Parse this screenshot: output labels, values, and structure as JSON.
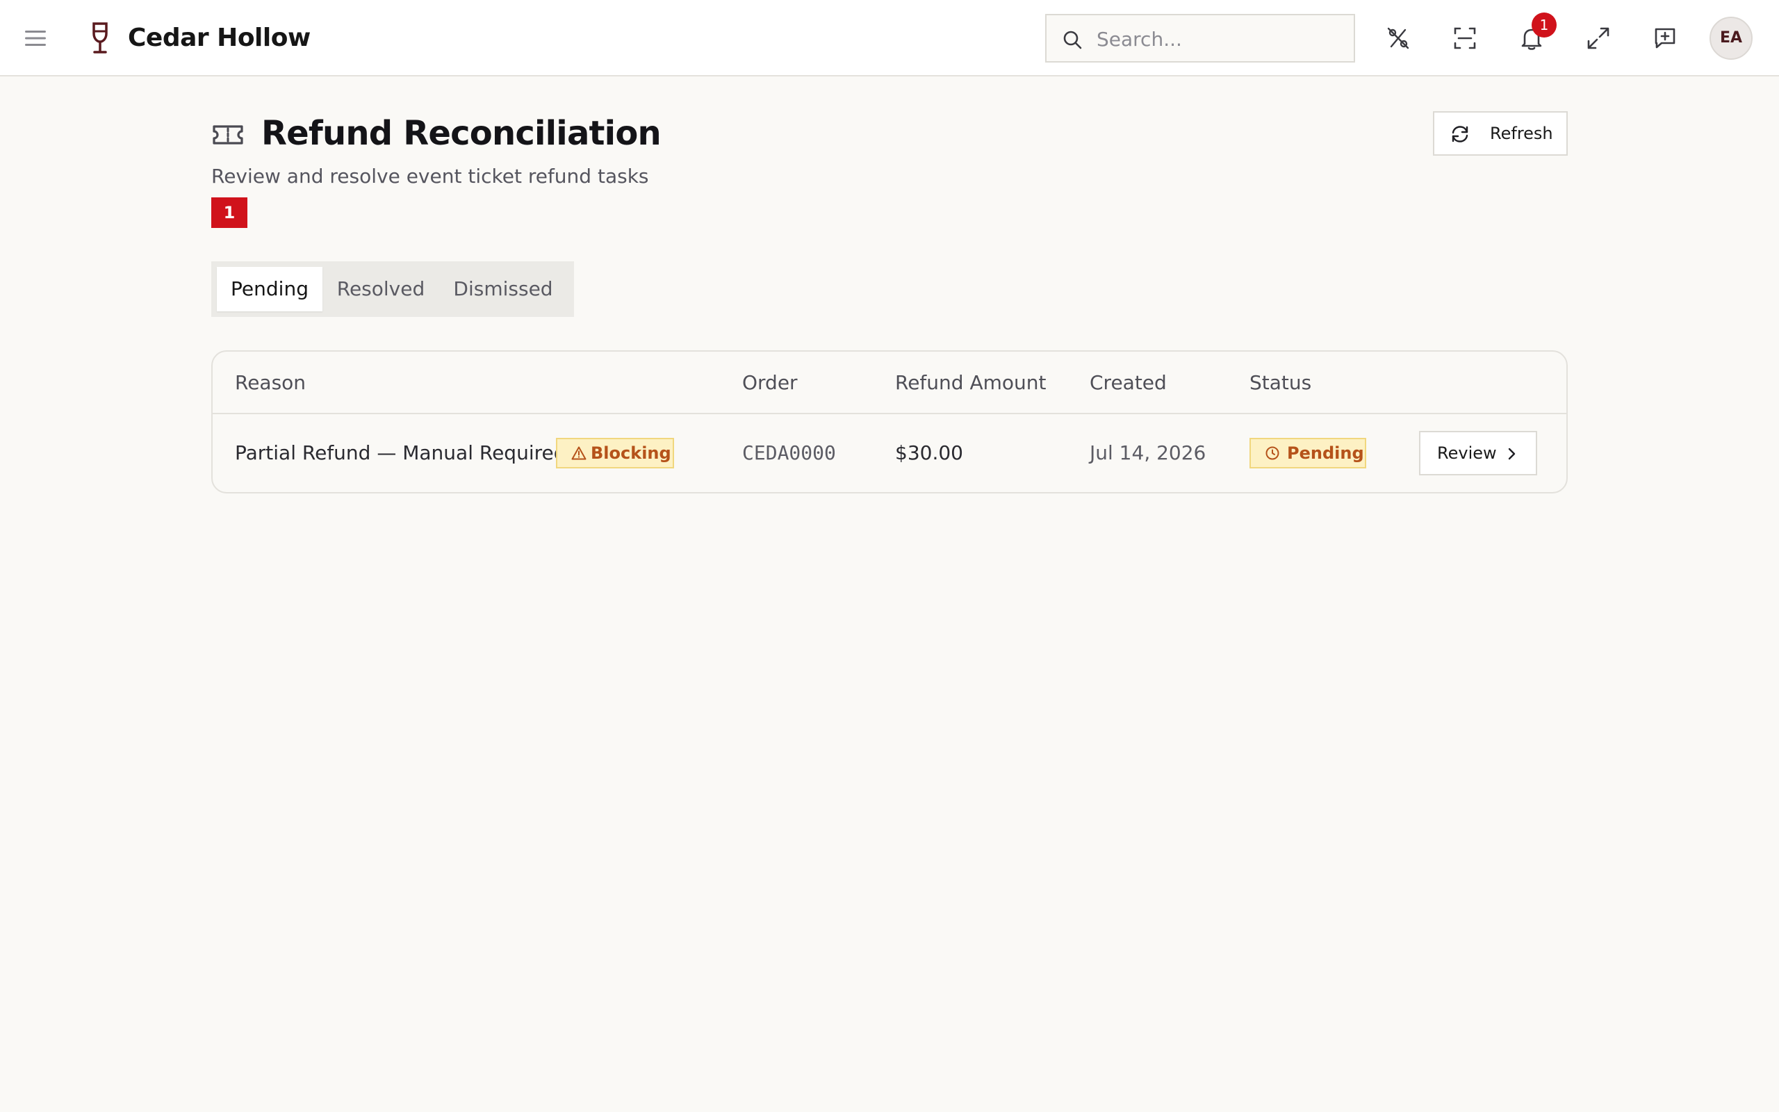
{
  "header": {
    "brand": "Cedar Hollow",
    "search_placeholder": "Search...",
    "notification_count": "1",
    "avatar_initials": "EA",
    "icons": [
      "menu-icon",
      "wine-glass-icon",
      "search-icon",
      "percent-off-icon",
      "scan-icon",
      "bell-icon",
      "expand-icon",
      "feedback-icon"
    ]
  },
  "page": {
    "title": "Refund Reconciliation",
    "subtitle": "Review and resolve event ticket refund tasks",
    "pending_count": "1",
    "refresh_label": "Refresh"
  },
  "tabs": [
    {
      "label": "Pending",
      "active": true
    },
    {
      "label": "Resolved",
      "active": false
    },
    {
      "label": "Dismissed",
      "active": false
    }
  ],
  "table": {
    "columns": [
      "Reason",
      "Order",
      "Refund Amount",
      "Created",
      "Status"
    ],
    "rows": [
      {
        "reason": "Partial Refund — Manual Required",
        "flag": "Blocking",
        "order": "CEDA0000",
        "amount": "$30.00",
        "created": "Jul 14, 2026",
        "status": "Pending",
        "action": "Review"
      }
    ]
  },
  "colors": {
    "accent_red": "#d0121b",
    "warning_bg": "#fdf1c4",
    "warning_text": "#b5521a",
    "brand_wine": "#5a1a1f"
  }
}
